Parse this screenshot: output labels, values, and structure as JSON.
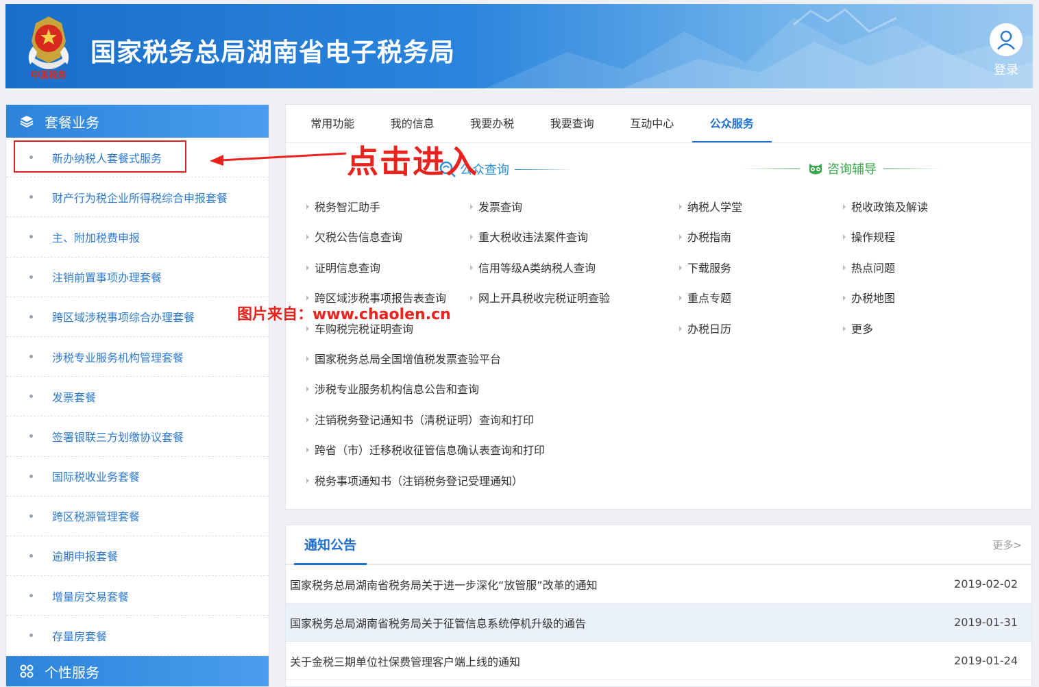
{
  "header": {
    "site_title": "国家税务总局湖南省电子税务局",
    "emblem_text": "中国税务",
    "login_label": "登录"
  },
  "sidebar": {
    "head_label": "套餐业务",
    "items": [
      "新办纳税人套餐式服务",
      "财产行为税企业所得税综合申报套餐",
      "主、附加税费申报",
      "注销前置事项办理套餐",
      "跨区域涉税事项综合办理套餐",
      "涉税专业服务机构管理套餐",
      "发票套餐",
      "签署银联三方划缴协议套餐",
      "国际税收业务套餐",
      "跨区税源管理套餐",
      "逾期申报套餐",
      "增量房交易套餐",
      "存量房套餐"
    ],
    "foot_label": "个性服务"
  },
  "tabs": [
    "常用功能",
    "我的信息",
    "我要办税",
    "我要查询",
    "互动中心",
    "公众服务"
  ],
  "active_tab": "公众服务",
  "public_query": {
    "title": "公众查询",
    "col1": [
      "税务智汇助手",
      "欠税公告信息查询",
      "证明信息查询",
      "跨区域涉税事项报告表查询",
      "车购税完税证明查询",
      "国家税务总局全国增值税发票查验平台",
      "涉税专业服务机构信息公告和查询",
      "注销税务登记通知书（清税证明）查询和打印",
      "跨省（市）迁移税收征管信息确认表查询和打印",
      "税务事项通知书（注销税务登记受理通知）"
    ],
    "col2": [
      "发票查询",
      "重大税收违法案件查询",
      "信用等级A类纳税人查询",
      "网上开具税收完税证明查验"
    ]
  },
  "consult": {
    "title": "咨询辅导",
    "col1": [
      "纳税人学堂",
      "办税指南",
      "下载服务",
      "重点专题",
      "办税日历"
    ],
    "col2": [
      "税收政策及解读",
      "操作规程",
      "热点问题",
      "办税地图",
      "更多"
    ]
  },
  "notice": {
    "title": "通知公告",
    "more": "更多>",
    "rows": [
      {
        "title": "国家税务总局湖南省税务局关于进一步深化“放管服”改革的通知",
        "date": "2019-02-02"
      },
      {
        "title": "国家税务总局湖南省税务局关于征管信息系统停机升级的通告",
        "date": "2019-01-31"
      },
      {
        "title": "关于金税三期单位社保费管理客户端上线的通知",
        "date": "2019-01-24"
      }
    ]
  },
  "annotations": {
    "click_hint": "点击进入",
    "source": "图片来自：www.chaolen.cn"
  },
  "colors": {
    "accent": "#1f6fd0",
    "annotation_red": "#e8231d",
    "query_teal": "#2a8fd8",
    "consult_green": "#3aa84a"
  }
}
